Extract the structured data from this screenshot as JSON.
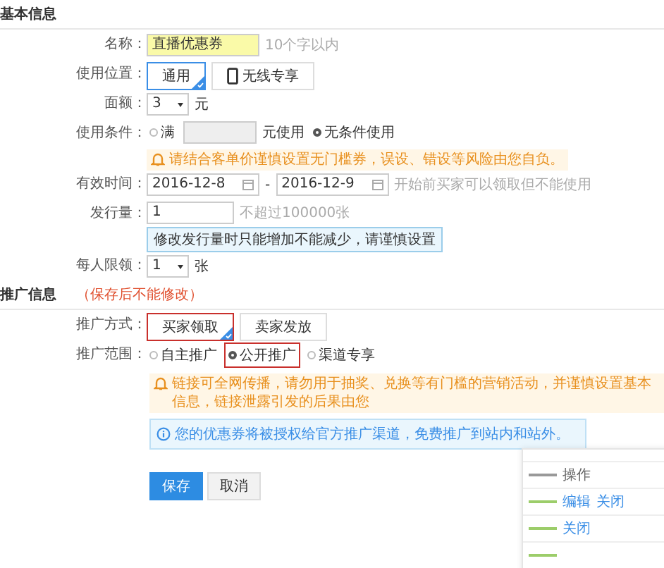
{
  "basic_section": {
    "title": "基本信息",
    "fields": [
      {
        "kind": "text",
        "label": "名称：",
        "value": "直播优惠券",
        "hint": "10个字以内"
      },
      {
        "kind": "toggle",
        "label": "使用位置：",
        "options": [
          {
            "label": "通用",
            "selected": true,
            "phone_icon": false,
            "outlined": false
          },
          {
            "label": "无线专享",
            "selected": false,
            "phone_icon": true,
            "outlined": false
          }
        ]
      },
      {
        "kind": "select",
        "label": "面额：",
        "value": "3",
        "unit": "元"
      },
      {
        "kind": "condition",
        "label": "使用条件：",
        "options": [
          {
            "label": "满",
            "selected": false
          },
          {
            "label": "无条件使用",
            "selected": true
          }
        ],
        "suffix": "元使用",
        "warning": "请结合客单价谨慎设置无门槛券，误设、错设等风险由您自负。"
      },
      {
        "kind": "daterange",
        "label": "有效时间：",
        "start": "2016-12-8",
        "separator": "-",
        "end": "2016-12-9",
        "hint": "开始前买家可以领取但不能使用"
      },
      {
        "kind": "number",
        "label": "发行量：",
        "value": "1",
        "hint": "不超过100000张",
        "tip": "修改发行量时只能增加不能减少，请谨慎设置"
      },
      {
        "kind": "select",
        "label": "每人限领：",
        "value": "1",
        "unit": "张"
      }
    ]
  },
  "promo_section": {
    "title": "推广信息",
    "note": "（保存后不能修改）",
    "fields": [
      {
        "kind": "toggle",
        "label": "推广方式：",
        "options": [
          {
            "label": "买家领取",
            "selected": true,
            "phone_icon": false,
            "outlined": true
          },
          {
            "label": "卖家发放",
            "selected": false,
            "phone_icon": false,
            "outlined": false
          }
        ]
      },
      {
        "kind": "radios",
        "label": "推广范围：",
        "options": [
          {
            "label": "自主推广",
            "selected": false,
            "outlined": false
          },
          {
            "label": "公开推广",
            "selected": true,
            "outlined": true
          },
          {
            "label": "渠道专享",
            "selected": false,
            "outlined": false
          }
        ]
      }
    ],
    "warning": "链接可全网传播，请勿用于抽奖、兑换等有门槛的营销活动，并谨慎设置基本信息，链接泄露引发的后果由您",
    "info": "您的优惠券将被授权给官方推广渠道，免费推广到站内和站外。"
  },
  "buttons": [
    {
      "label": "保存",
      "kind": "primary"
    },
    {
      "label": "取消",
      "kind": "secondary"
    }
  ],
  "preview": {
    "texts": [
      "操作",
      "编辑",
      "关闭",
      "关闭"
    ]
  }
}
